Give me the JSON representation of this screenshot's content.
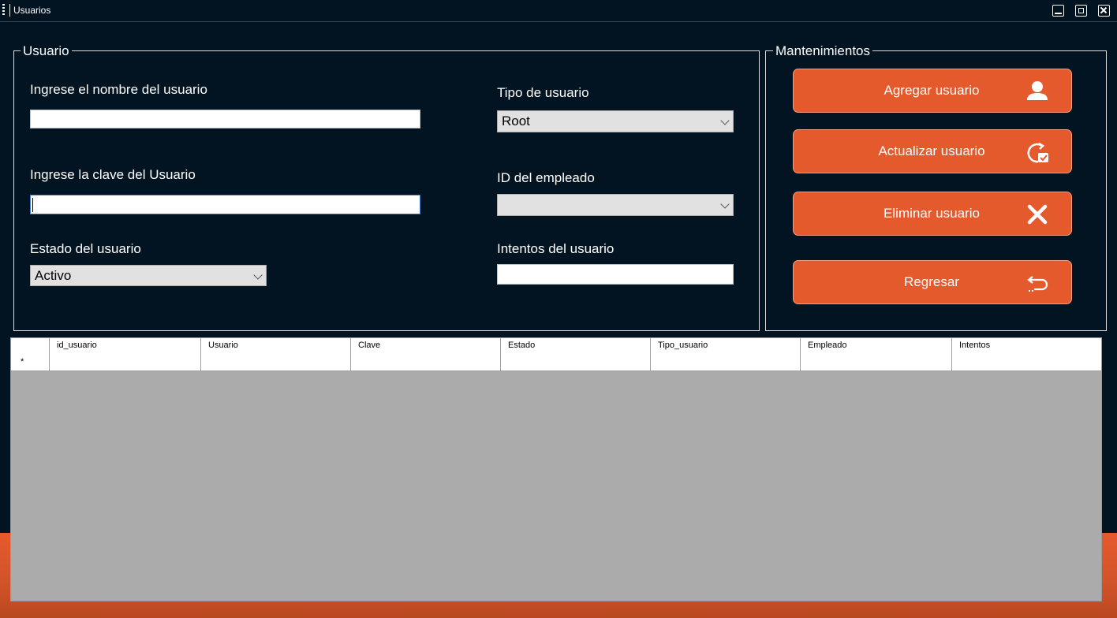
{
  "window": {
    "title": "Usuarios"
  },
  "usuario_group": {
    "title": "Usuario",
    "nombre_label": "Ingrese el nombre del usuario",
    "nombre_value": "",
    "clave_label": "Ingrese la clave del Usuario",
    "clave_value": "",
    "estado_label": "Estado del usuario",
    "estado_value": "Activo",
    "tipo_label": "Tipo de usuario",
    "tipo_value": "Root",
    "empleado_label": "ID del empleado",
    "empleado_value": "",
    "intentos_label": "Intentos del usuario",
    "intentos_value": ""
  },
  "mantenimientos": {
    "title": "Mantenimientos",
    "agregar": "Agregar usuario",
    "actualizar": "Actualizar usuario",
    "eliminar": "Eliminar usuario",
    "regresar": "Regresar"
  },
  "grid": {
    "columns": [
      "id_usuario",
      "Usuario",
      "Clave",
      "Estado",
      "Tipo_usuario",
      "Empleado",
      "Intentos"
    ],
    "new_row_marker": "*"
  },
  "colors": {
    "background": "#021321",
    "accent": "#e55a2c",
    "grid_empty": "#ababab"
  },
  "icons": {
    "agregar": "user-icon",
    "actualizar": "refresh-check-icon",
    "eliminar": "close-x-icon",
    "regresar": "return-arrow-icon"
  }
}
